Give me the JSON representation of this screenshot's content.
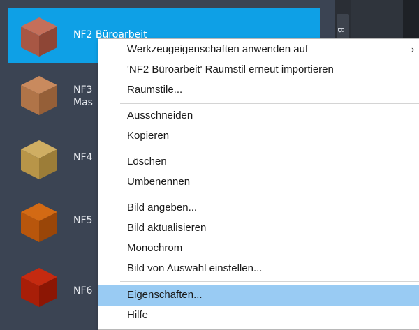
{
  "palette": {
    "items": [
      {
        "label": "NF2 Büroarbeit",
        "color_top": "#c56f5a",
        "color_left": "#a85744",
        "color_right": "#8e4636"
      },
      {
        "label": "NF3\nMas",
        "color_top": "#c98a5e",
        "color_left": "#b07448",
        "color_right": "#955f38"
      },
      {
        "label": "NF4",
        "color_top": "#cfae63",
        "color_left": "#b89548",
        "color_right": "#9c7d38"
      },
      {
        "label": "NF5",
        "color_top": "#d36a14",
        "color_left": "#b8560c",
        "color_right": "#9a4608"
      },
      {
        "label": "NF6",
        "color_top": "#c52a10",
        "color_left": "#a81e08",
        "color_right": "#8c1604"
      }
    ]
  },
  "side_tab_label": "B",
  "colors": {
    "selection": "#0ea0e6",
    "menu_highlight": "#99cbf3"
  },
  "context_menu": {
    "items": [
      {
        "label": "Werkzeugeigenschaften anwenden auf",
        "has_submenu": true
      },
      {
        "label": "'NF2 Büroarbeit' Raumstil erneut importieren"
      },
      {
        "label": "Raumstile..."
      },
      {
        "label": "Ausschneiden"
      },
      {
        "label": "Kopieren"
      },
      {
        "label": "Löschen"
      },
      {
        "label": "Umbenennen"
      },
      {
        "label": "Bild angeben..."
      },
      {
        "label": "Bild aktualisieren"
      },
      {
        "label": "Monochrom"
      },
      {
        "label": "Bild von Auswahl einstellen..."
      },
      {
        "label": "Eigenschaften...",
        "highlighted": true
      },
      {
        "label": "Hilfe"
      }
    ],
    "submenu_arrow": "›"
  }
}
